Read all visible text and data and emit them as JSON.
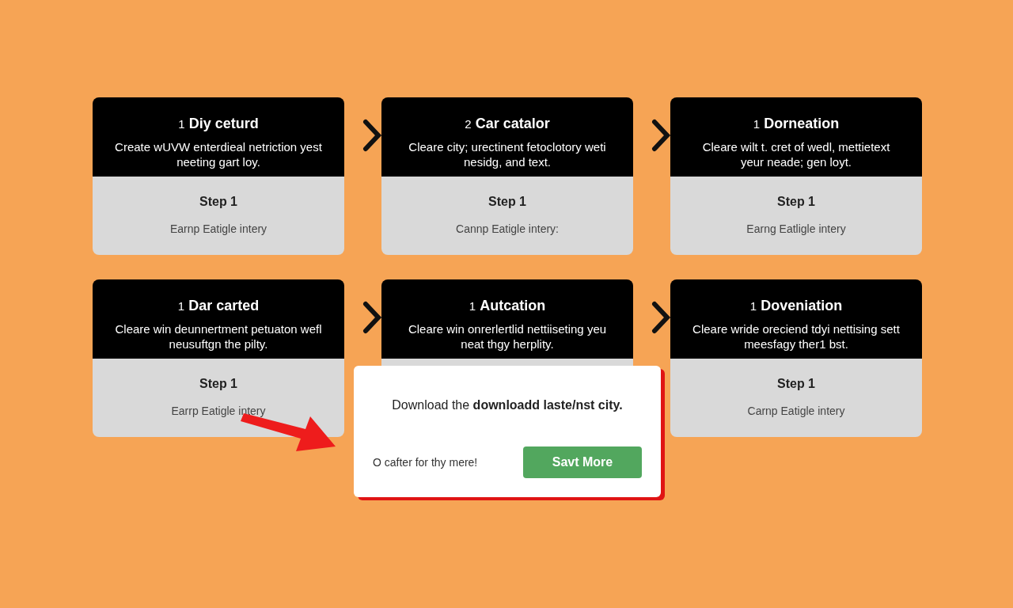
{
  "cards": [
    {
      "number": "1",
      "title": "Diy ceturd",
      "description": "Create wUVW enterdieal netriction yest neeting gart loy.",
      "step": "Step 1",
      "subtitle": "Earnp Eatigle intery",
      "chevron_before": false
    },
    {
      "number": "2",
      "title": "Car catalor",
      "description": "Cleare city; urectinent fetoclotory weti nesidg, and text.",
      "step": "Step 1",
      "subtitle": "Cannp Eatigle intery:",
      "chevron_before": true
    },
    {
      "number": "1",
      "title": "Dorneation",
      "description": "Cleare wilt t. cret of wedl, mettietext yeur neade; gen loyt.",
      "step": "Step 1",
      "subtitle": "Earng Eatligle intery",
      "chevron_before": true
    },
    {
      "number": "1",
      "title": "Dar carted",
      "description": "Cleare win deunnertment petuaton wefl neusuftgn the pilty.",
      "step": "Step 1",
      "subtitle": "Earrp Eatigle intery",
      "chevron_before": false
    },
    {
      "number": "1",
      "title": "Autcation",
      "description": "Cleare win onrerlertlid nettiiseting yeu neat thgy herplity.",
      "chevron_before": true
    },
    {
      "number": "1",
      "title": "Doveniation",
      "description": "Cleare wride oreciend tdyi nettising sett meesfagy ther1 bst.",
      "step": "Step 1",
      "subtitle": "Carnp Eatigle intery",
      "chevron_before": true
    }
  ],
  "popup": {
    "message": "Download the **downloadd laste/nst city.**",
    "note": "O cafter for thy mere!",
    "button": "Savt More"
  }
}
